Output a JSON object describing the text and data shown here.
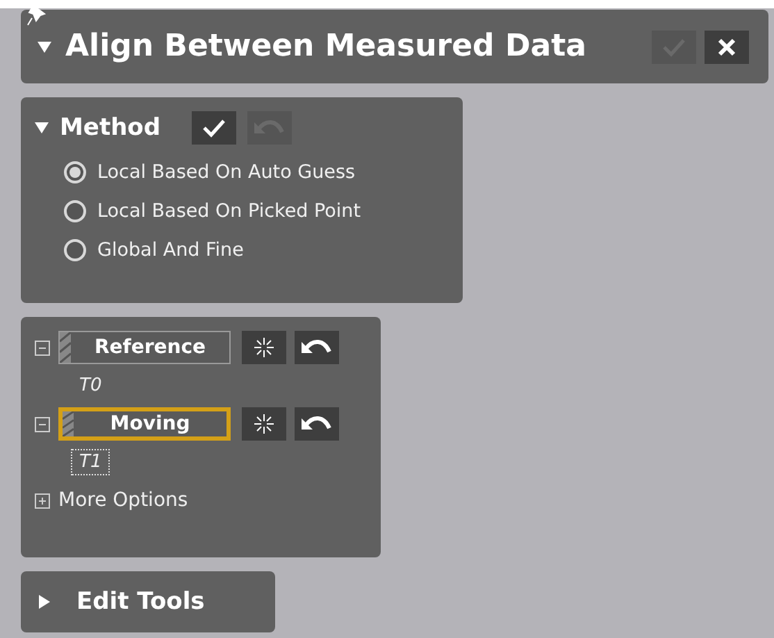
{
  "header": {
    "title": "Align Between Measured Data",
    "expanded": true,
    "ok_disabled": true
  },
  "method": {
    "title": "Method",
    "expanded": true,
    "apply_disabled": false,
    "undo_disabled": true,
    "options": [
      {
        "label": "Local Based On Auto Guess",
        "selected": true
      },
      {
        "label": "Local Based On Picked Point",
        "selected": false
      },
      {
        "label": "Global And Fine",
        "selected": false
      }
    ]
  },
  "datasets": [
    {
      "label": "Reference",
      "item": "T0",
      "active": false,
      "expanded": true
    },
    {
      "label": "Moving",
      "item": "T1",
      "active": true,
      "expanded": true
    }
  ],
  "more_options": {
    "label": "More Options",
    "expanded": false
  },
  "edit_tools": {
    "title": "Edit Tools",
    "expanded": false
  }
}
